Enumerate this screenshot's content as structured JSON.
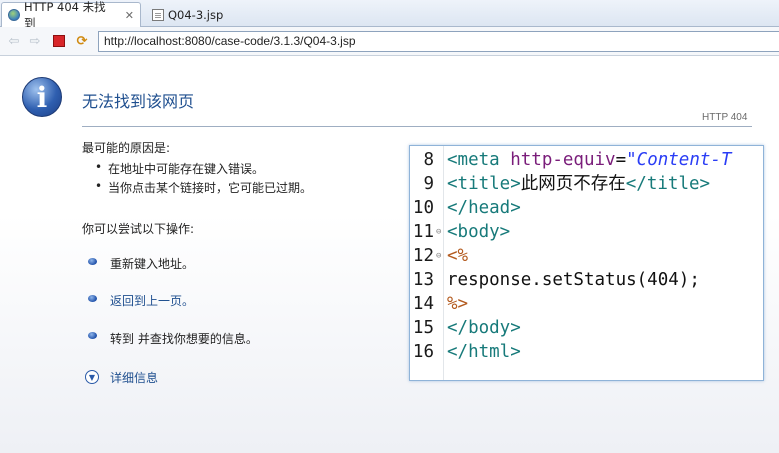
{
  "tabs": [
    {
      "label": "HTTP 404 未找到",
      "icon": "globe-icon",
      "close": "✕",
      "active": true
    },
    {
      "label": "Q04-3.jsp",
      "icon": "jsp-file-icon",
      "active": false
    }
  ],
  "toolbar": {
    "url": "http://localhost:8080/case-code/3.1.3/Q04-3.jsp"
  },
  "page": {
    "title": "无法找到该网页",
    "status_code": "HTTP 404",
    "reasons_heading": "最可能的原因是:",
    "reasons": [
      "在地址中可能存在键入错误。",
      "当你点击某个链接时，它可能已过期。"
    ],
    "try_heading": "你可以尝试以下操作:",
    "actions": [
      {
        "label": "重新键入地址。",
        "link": false
      },
      {
        "label": "返回到上一页。",
        "link": true
      },
      {
        "label": "转到  并查找你想要的信息。",
        "link": false
      }
    ],
    "details_label": "详细信息"
  },
  "code": {
    "lines": [
      {
        "num": "8",
        "fold": false,
        "tokens": [
          {
            "t": "<meta ",
            "c": "tag"
          },
          {
            "t": "http-equiv",
            "c": "attr"
          },
          {
            "t": "=",
            "c": "txt"
          },
          {
            "t": "\"Content-T",
            "c": "str"
          }
        ]
      },
      {
        "num": "9",
        "fold": false,
        "tokens": [
          {
            "t": "<title>",
            "c": "tag"
          },
          {
            "t": "此网页不存在",
            "c": "txt"
          },
          {
            "t": "</title>",
            "c": "tag"
          }
        ]
      },
      {
        "num": "10",
        "fold": false,
        "tokens": [
          {
            "t": "</head>",
            "c": "tag"
          }
        ]
      },
      {
        "num": "11",
        "fold": true,
        "tokens": [
          {
            "t": "<body>",
            "c": "tag"
          }
        ]
      },
      {
        "num": "12",
        "fold": true,
        "tokens": [
          {
            "t": "<%",
            "c": "jsp"
          }
        ]
      },
      {
        "num": "13",
        "fold": false,
        "tokens": [
          {
            "t": "response.setStatus(404);",
            "c": "txt"
          }
        ]
      },
      {
        "num": "14",
        "fold": false,
        "tokens": [
          {
            "t": "%>",
            "c": "jsp"
          }
        ]
      },
      {
        "num": "15",
        "fold": false,
        "tokens": [
          {
            "t": "</body>",
            "c": "tag"
          }
        ]
      },
      {
        "num": "16",
        "fold": false,
        "tokens": [
          {
            "t": "</html>",
            "c": "tag"
          }
        ]
      }
    ]
  }
}
